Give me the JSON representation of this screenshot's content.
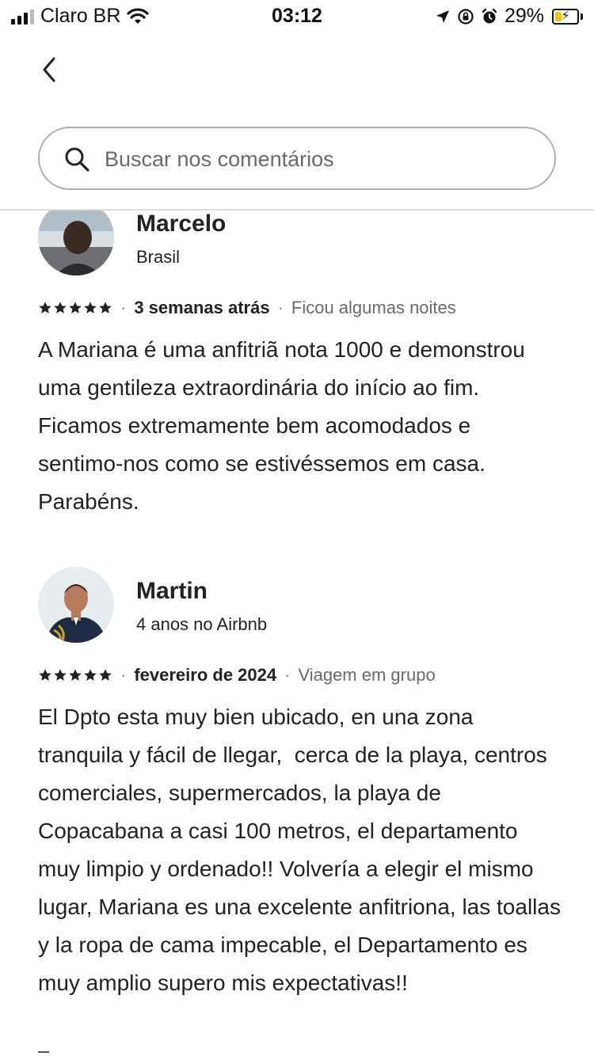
{
  "status_bar": {
    "carrier": "Claro BR",
    "time": "03:12",
    "battery": "29%",
    "battery_level": 0.29,
    "icons": [
      "signal-icon",
      "wifi-icon",
      "location-arrow-icon",
      "orientation-lock-icon",
      "alarm-icon",
      "battery-icon"
    ]
  },
  "nav": {
    "back_icon": "chevron-left-icon"
  },
  "search": {
    "placeholder": "Buscar nos comentários",
    "value": "",
    "icon": "search-icon"
  },
  "reviews": [
    {
      "name": "Marcelo",
      "subtitle": "Brasil",
      "rating": 5,
      "date": "3 semanas atrás",
      "stay": "Ficou algumas noites",
      "text": "A Mariana é uma anfitriã nota 1000 e demonstrou uma gentileza extraordinária do início ao fim.   Ficamos extremamente bem acomodados e sentimo-nos como se estivéssemos em casa. Parabéns."
    },
    {
      "name": "Martin",
      "subtitle": "4 anos no Airbnb",
      "rating": 5,
      "date": "fevereiro de 2024",
      "stay": "Viagem em grupo",
      "text": "El Dpto esta muy bien ubicado, en una zona tranquila y fácil de llegar,  cerca de la playa, centros comerciales, supermercados, la playa de Copacabana a casi 100 metros, el departamento muy limpio y ordenado!! Volvería a elegir el mismo lugar, Mariana es una excelente anfitriona, las toallas y la ropa de cama impecable, el Departamento es muy amplio supero mis expectativas!!"
    }
  ],
  "colors": {
    "text": "#222222",
    "secondary": "#6a6a6a",
    "border": "#b0b0b0",
    "battery": "#f5c400"
  }
}
